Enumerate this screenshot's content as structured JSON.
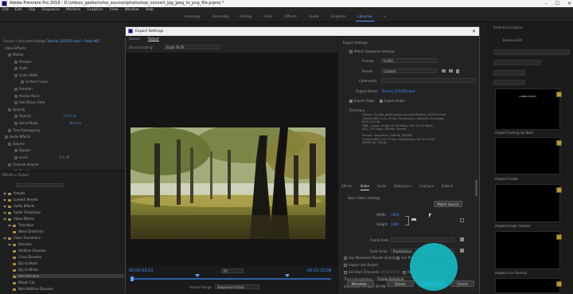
{
  "app": {
    "title": "Adobe Premiere Pro 2018 - D:\\videos_geeksinvivo_sources\\photoshop_convert_jpg_jpeg_to_png_file.prproj *",
    "window_controls": [
      "–",
      "☐",
      "✕"
    ]
  },
  "menu": [
    "File",
    "Edit",
    "Clip",
    "Sequence",
    "Markers",
    "Graphics",
    "View",
    "Window",
    "Help"
  ],
  "workspaces": [
    "Learning",
    "Assembly",
    "Editing",
    "Color",
    "Effects",
    "Audio",
    "Graphics",
    "Libraries"
  ],
  "workspaces_more": "»",
  "left_panel": {
    "tabs": [
      "Source • Unscaled footage",
      "Tutorial_163200.mp4 • Seqn-ABC"
    ],
    "video_effects_label": "Video Effects",
    "rows": [
      "Motion",
      "Position",
      "Scale",
      "Scale Width",
      "Uniform Scale",
      "Rotation",
      "Anchor Point",
      "Anti-flicker Filter",
      "Opacity",
      "Opacity",
      "Blend Mode",
      "Time Remapping",
      "Audio Effects",
      "Volume",
      "Bypass",
      "Level",
      "Channel Volume",
      "Bypass"
    ],
    "values": [
      "",
      "",
      "",
      "",
      "",
      "",
      "",
      "",
      "",
      "100.0 %",
      "Normal",
      "",
      "",
      "",
      "",
      "0.0 dB",
      "",
      ""
    ]
  },
  "project_panel": {
    "tabs": "Effects  ≡   Project",
    "search_placeholder": "",
    "tree": [
      "Presets",
      "Lumetri Presets",
      "Audio Effects",
      "Audio Transitions",
      "Video Effects",
      "Transition",
      "Wave Distortion",
      "Video Transitions",
      "Dissolve",
      "Additive Dissolve",
      "Cross Dissolve",
      "Dip to Black",
      "Dip to White",
      "Film Dissolve",
      "Morph Cut",
      "Non-Additive Dissolve"
    ]
  },
  "right_panel": {
    "tabs": "Essential Graphics",
    "subtabs": "Browse   Edit",
    "thumbs": [
      "Angled Coming Up Next",
      "Angled Credits",
      "Angled Image Caption",
      "Angled Line Overlay"
    ],
    "thumb_text": [
      "COMING UP NEXT",
      "",
      "",
      ""
    ]
  },
  "dialog": {
    "title": "Export Settings",
    "close": "✕",
    "tabs": [
      "Source",
      "Output"
    ],
    "source_scaling_label": "Source Scaling:",
    "source_scaling_value": "Scale To Fit",
    "timecode_in": "00:00:03:02",
    "timecode_out": "00:01:23:08",
    "fit_value": "Fit",
    "source_range_label": "Source Range:",
    "source_range_value": "Sequence In/Out",
    "export_settings_header": "Export Settings",
    "match_sequence": "Match Sequence Settings",
    "format_label": "Format:",
    "format_value": "H.264",
    "preset_label": "Preset:",
    "preset_value": "Custom",
    "comments_label": "Comments:",
    "output_name_label": "Output Name:",
    "output_name_value": "Tutorial_163200.mp4",
    "export_video": "Export Video",
    "export_audio": "Export Audio",
    "summary_label": "Summary",
    "summary_output": "Output: D:\\vids_geeksinvivo_sources\\Tutorial_163200.mp4\n1920x1080 (1.0), 25 fps, Progressive, Software Encoding, 00:01:23:08\nVBR, 1 pass, Target 10.00 Mbps, Max 12.00 Mbps\nAAC, 320 kbps, 48 kHz, Stereo",
    "summary_source": "Source: Sequence, Tutorial_163200\n1920x1080 (1.0), 25 fps, Progressive, 00:01:23:08\n48000 Hz, Stereo",
    "video_tabs": [
      "Effects",
      "Video",
      "Audio",
      "Multiplexer",
      "Captions",
      "Publish"
    ],
    "basic_video_settings": "Basic Video Settings",
    "match_source_btn": "Match Source",
    "width_label": "Width:",
    "width_value": "1920",
    "height_label": "Height:",
    "height_value": "1080",
    "frame_rate_label": "Frame Rate:",
    "field_order_label": "Field Order:",
    "field_order_value": "Progressive",
    "use_max_render": "Use Maximum Render Quality",
    "use_previews": "Use Previews",
    "import_into_project": "Import into Project",
    "set_start_timecode": "Set Start Timecode",
    "start_timecode_value": "00:00:00:00",
    "render_alpha": "Render Alpha Channel Only",
    "time_interp_label": "Time Interpolation:",
    "time_interp_value": "Frame Sampling",
    "est_file_size_label": "Estimated File Size:",
    "est_file_size_value": "99 MB",
    "metadata_btn": "Metadata...",
    "queue_btn": "Queue",
    "export_btn": "Export",
    "cancel_btn": "Cancel"
  }
}
